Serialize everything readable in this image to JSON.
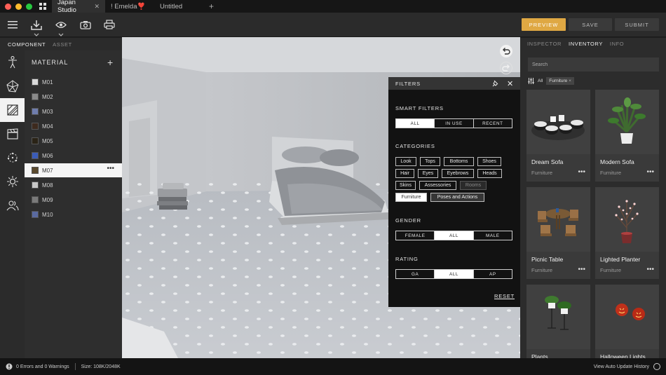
{
  "tabs": [
    {
      "label": "Japan Studio",
      "active": true
    },
    {
      "label": "! Emelda❣️",
      "active": false
    },
    {
      "label": "Untitled",
      "active": false
    }
  ],
  "toolbar": {
    "preview_label": "PREVIEW",
    "save_label": "SAVE",
    "submit_label": "SUBMIT",
    "accent_color": "#dfa843"
  },
  "left": {
    "tabs": [
      "COMPONENT",
      "ASSET"
    ],
    "active_tab": "COMPONENT",
    "rail_icons": [
      "figure-icon",
      "mesh-icon",
      "material-icon",
      "clapper-icon",
      "particles-icon",
      "light-icon",
      "people-icon"
    ],
    "material_title": "MATERIAL",
    "materials": [
      {
        "label": "M01",
        "color": "#d9d9d9"
      },
      {
        "label": "M02",
        "color": "#8a8a8a"
      },
      {
        "label": "M03",
        "color": "#6f7dad"
      },
      {
        "label": "M04",
        "color": "#3d2a1e"
      },
      {
        "label": "M05",
        "color": "#2a2316"
      },
      {
        "label": "M06",
        "color": "#3b5cb8"
      },
      {
        "label": "M07",
        "color": "#5b4a2e",
        "active": true
      },
      {
        "label": "M08",
        "color": "#c8c8c8"
      },
      {
        "label": "M09",
        "color": "#7a7a7a"
      },
      {
        "label": "M10",
        "color": "#5a6aa0"
      }
    ]
  },
  "filters": {
    "title": "FILTERS",
    "smart_label": "SMART FILTERS",
    "smart_options": [
      "ALL",
      "IN USE",
      "RECENT"
    ],
    "smart_selected": "ALL",
    "categories_label": "CATEGORIES",
    "categories": [
      "Look",
      "Tops",
      "Bottoms",
      "Shoes",
      "Hair",
      "Eyes",
      "Eyebrows",
      "Heads",
      "Skins",
      "Assessories",
      "Rooms",
      "Furniture",
      "Poses and Actions"
    ],
    "gender_label": "GENDER",
    "gender_options": [
      "FEMALE",
      "ALL",
      "MALE"
    ],
    "gender_selected": "ALL",
    "rating_label": "RATING",
    "rating_options": [
      "GA",
      "ALL",
      "AP"
    ],
    "rating_selected": "ALL",
    "reset_label": "RESET"
  },
  "right": {
    "tabs": [
      "INSPECTOR",
      "INVENTORY",
      "INFO"
    ],
    "active_tab": "INVENTORY",
    "search_placeholder": "Search",
    "filter_all": "All",
    "filter_tag": "Furniture",
    "filter_tag_close": "×",
    "items": [
      {
        "name": "Dream Sofa",
        "category": "Furniture"
      },
      {
        "name": "Modern Sofa",
        "category": "Furniture"
      },
      {
        "name": "Picnic Table",
        "category": "Furniture"
      },
      {
        "name": "Lighted Planter",
        "category": "Furniture"
      },
      {
        "name": "Plants",
        "category": ""
      },
      {
        "name": "Halloween Lights",
        "category": ""
      }
    ]
  },
  "status": {
    "errors": "0 Errors and 0 Warnings",
    "size": "Size: 108K/2048K",
    "history": "View Auto Update History"
  }
}
